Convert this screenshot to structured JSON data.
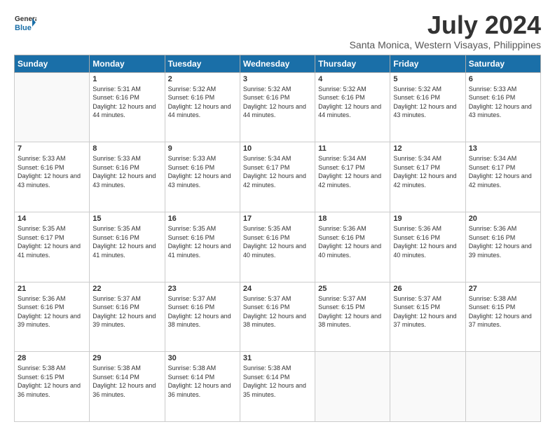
{
  "logo": {
    "line1": "General",
    "line2": "Blue"
  },
  "title": "July 2024",
  "location": "Santa Monica, Western Visayas, Philippines",
  "days_of_week": [
    "Sunday",
    "Monday",
    "Tuesday",
    "Wednesday",
    "Thursday",
    "Friday",
    "Saturday"
  ],
  "weeks": [
    [
      {
        "day": "",
        "sunrise": "",
        "sunset": "",
        "daylight": ""
      },
      {
        "day": "1",
        "sunrise": "Sunrise: 5:31 AM",
        "sunset": "Sunset: 6:16 PM",
        "daylight": "Daylight: 12 hours and 44 minutes."
      },
      {
        "day": "2",
        "sunrise": "Sunrise: 5:32 AM",
        "sunset": "Sunset: 6:16 PM",
        "daylight": "Daylight: 12 hours and 44 minutes."
      },
      {
        "day": "3",
        "sunrise": "Sunrise: 5:32 AM",
        "sunset": "Sunset: 6:16 PM",
        "daylight": "Daylight: 12 hours and 44 minutes."
      },
      {
        "day": "4",
        "sunrise": "Sunrise: 5:32 AM",
        "sunset": "Sunset: 6:16 PM",
        "daylight": "Daylight: 12 hours and 44 minutes."
      },
      {
        "day": "5",
        "sunrise": "Sunrise: 5:32 AM",
        "sunset": "Sunset: 6:16 PM",
        "daylight": "Daylight: 12 hours and 43 minutes."
      },
      {
        "day": "6",
        "sunrise": "Sunrise: 5:33 AM",
        "sunset": "Sunset: 6:16 PM",
        "daylight": "Daylight: 12 hours and 43 minutes."
      }
    ],
    [
      {
        "day": "7",
        "sunrise": "Sunrise: 5:33 AM",
        "sunset": "Sunset: 6:16 PM",
        "daylight": "Daylight: 12 hours and 43 minutes."
      },
      {
        "day": "8",
        "sunrise": "Sunrise: 5:33 AM",
        "sunset": "Sunset: 6:16 PM",
        "daylight": "Daylight: 12 hours and 43 minutes."
      },
      {
        "day": "9",
        "sunrise": "Sunrise: 5:33 AM",
        "sunset": "Sunset: 6:16 PM",
        "daylight": "Daylight: 12 hours and 43 minutes."
      },
      {
        "day": "10",
        "sunrise": "Sunrise: 5:34 AM",
        "sunset": "Sunset: 6:17 PM",
        "daylight": "Daylight: 12 hours and 42 minutes."
      },
      {
        "day": "11",
        "sunrise": "Sunrise: 5:34 AM",
        "sunset": "Sunset: 6:17 PM",
        "daylight": "Daylight: 12 hours and 42 minutes."
      },
      {
        "day": "12",
        "sunrise": "Sunrise: 5:34 AM",
        "sunset": "Sunset: 6:17 PM",
        "daylight": "Daylight: 12 hours and 42 minutes."
      },
      {
        "day": "13",
        "sunrise": "Sunrise: 5:34 AM",
        "sunset": "Sunset: 6:17 PM",
        "daylight": "Daylight: 12 hours and 42 minutes."
      }
    ],
    [
      {
        "day": "14",
        "sunrise": "Sunrise: 5:35 AM",
        "sunset": "Sunset: 6:17 PM",
        "daylight": "Daylight: 12 hours and 41 minutes."
      },
      {
        "day": "15",
        "sunrise": "Sunrise: 5:35 AM",
        "sunset": "Sunset: 6:16 PM",
        "daylight": "Daylight: 12 hours and 41 minutes."
      },
      {
        "day": "16",
        "sunrise": "Sunrise: 5:35 AM",
        "sunset": "Sunset: 6:16 PM",
        "daylight": "Daylight: 12 hours and 41 minutes."
      },
      {
        "day": "17",
        "sunrise": "Sunrise: 5:35 AM",
        "sunset": "Sunset: 6:16 PM",
        "daylight": "Daylight: 12 hours and 40 minutes."
      },
      {
        "day": "18",
        "sunrise": "Sunrise: 5:36 AM",
        "sunset": "Sunset: 6:16 PM",
        "daylight": "Daylight: 12 hours and 40 minutes."
      },
      {
        "day": "19",
        "sunrise": "Sunrise: 5:36 AM",
        "sunset": "Sunset: 6:16 PM",
        "daylight": "Daylight: 12 hours and 40 minutes."
      },
      {
        "day": "20",
        "sunrise": "Sunrise: 5:36 AM",
        "sunset": "Sunset: 6:16 PM",
        "daylight": "Daylight: 12 hours and 39 minutes."
      }
    ],
    [
      {
        "day": "21",
        "sunrise": "Sunrise: 5:36 AM",
        "sunset": "Sunset: 6:16 PM",
        "daylight": "Daylight: 12 hours and 39 minutes."
      },
      {
        "day": "22",
        "sunrise": "Sunrise: 5:37 AM",
        "sunset": "Sunset: 6:16 PM",
        "daylight": "Daylight: 12 hours and 39 minutes."
      },
      {
        "day": "23",
        "sunrise": "Sunrise: 5:37 AM",
        "sunset": "Sunset: 6:16 PM",
        "daylight": "Daylight: 12 hours and 38 minutes."
      },
      {
        "day": "24",
        "sunrise": "Sunrise: 5:37 AM",
        "sunset": "Sunset: 6:16 PM",
        "daylight": "Daylight: 12 hours and 38 minutes."
      },
      {
        "day": "25",
        "sunrise": "Sunrise: 5:37 AM",
        "sunset": "Sunset: 6:15 PM",
        "daylight": "Daylight: 12 hours and 38 minutes."
      },
      {
        "day": "26",
        "sunrise": "Sunrise: 5:37 AM",
        "sunset": "Sunset: 6:15 PM",
        "daylight": "Daylight: 12 hours and 37 minutes."
      },
      {
        "day": "27",
        "sunrise": "Sunrise: 5:38 AM",
        "sunset": "Sunset: 6:15 PM",
        "daylight": "Daylight: 12 hours and 37 minutes."
      }
    ],
    [
      {
        "day": "28",
        "sunrise": "Sunrise: 5:38 AM",
        "sunset": "Sunset: 6:15 PM",
        "daylight": "Daylight: 12 hours and 36 minutes."
      },
      {
        "day": "29",
        "sunrise": "Sunrise: 5:38 AM",
        "sunset": "Sunset: 6:14 PM",
        "daylight": "Daylight: 12 hours and 36 minutes."
      },
      {
        "day": "30",
        "sunrise": "Sunrise: 5:38 AM",
        "sunset": "Sunset: 6:14 PM",
        "daylight": "Daylight: 12 hours and 36 minutes."
      },
      {
        "day": "31",
        "sunrise": "Sunrise: 5:38 AM",
        "sunset": "Sunset: 6:14 PM",
        "daylight": "Daylight: 12 hours and 35 minutes."
      },
      {
        "day": "",
        "sunrise": "",
        "sunset": "",
        "daylight": ""
      },
      {
        "day": "",
        "sunrise": "",
        "sunset": "",
        "daylight": ""
      },
      {
        "day": "",
        "sunrise": "",
        "sunset": "",
        "daylight": ""
      }
    ]
  ]
}
